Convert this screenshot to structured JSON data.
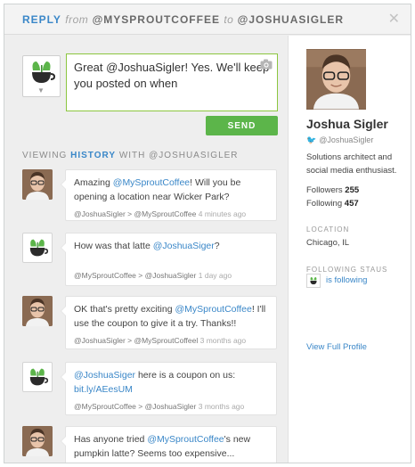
{
  "header": {
    "reply_label": "REPLY",
    "from_word": "from",
    "from_handle": "@MYSPROUTCOFFEE",
    "to_word": "to",
    "to_handle": "@JOSHUASIGLER",
    "close_glyph": "✕"
  },
  "composer": {
    "value": "Great @JoshuaSigler! Yes. We'll keep you posted on when"
  },
  "send_label": "SEND",
  "history_label": {
    "prefix": "VIEWING",
    "highlight": "HISTORY",
    "suffix": "WITH @JOSHUASIGLER"
  },
  "messages": [
    {
      "author": "josh",
      "parts": {
        "pre": "Amazing ",
        "link": "@MySproutCoffee",
        "post": "! Will you be opening a location near Wicker Park?"
      },
      "meta_from": "@JoshuaSigler",
      "meta_to": "@MySproutCoffee",
      "time": "4 minutes ago"
    },
    {
      "author": "sprout",
      "parts": {
        "pre": "How was that latte ",
        "link": "@JoshuaSiger",
        "post": "?"
      },
      "meta_from": "@MySproutCoffee",
      "meta_to": "@JoshuaSigler",
      "time": "1 day ago"
    },
    {
      "author": "josh",
      "parts": {
        "pre": "OK that's pretty exciting ",
        "link": "@MySproutCoffee",
        "post": "! I'll use the coupon to give it a try. Thanks!!"
      },
      "meta_from": "@JoshuaSigler",
      "meta_to": "@MySproutCoffeel",
      "time": "3 months ago"
    },
    {
      "author": "sprout",
      "parts": {
        "pre": "",
        "link": "@JoshuaSiger",
        "post": " here is a coupon on us:",
        "link2": "bit.ly/AEesUM"
      },
      "meta_from": "@MySproutCoffee",
      "meta_to": "@JoshuaSigler",
      "time": "3 months ago"
    },
    {
      "author": "josh",
      "parts": {
        "pre": "Has anyone tried ",
        "link": "@MySproutCoffee",
        "post": "'s new pumpkin latte? Seems too expensive..."
      }
    }
  ],
  "profile": {
    "name": "Joshua Sigler",
    "handle": "@JoshuaSigler",
    "bio": "Solutions architect and social media enthusiast.",
    "followers_label": "Followers",
    "followers": "255",
    "following_label": "Following",
    "following": "457",
    "location_label": "LOCATION",
    "location": "Chicago, IL",
    "following_status_label": "FOLLOWING STAUS",
    "following_status": "is following",
    "view_profile": "View Full Profile"
  },
  "colors": {
    "accent": "#3a87c8",
    "send": "#5cb54a",
    "composer_border": "#8cc63f"
  }
}
